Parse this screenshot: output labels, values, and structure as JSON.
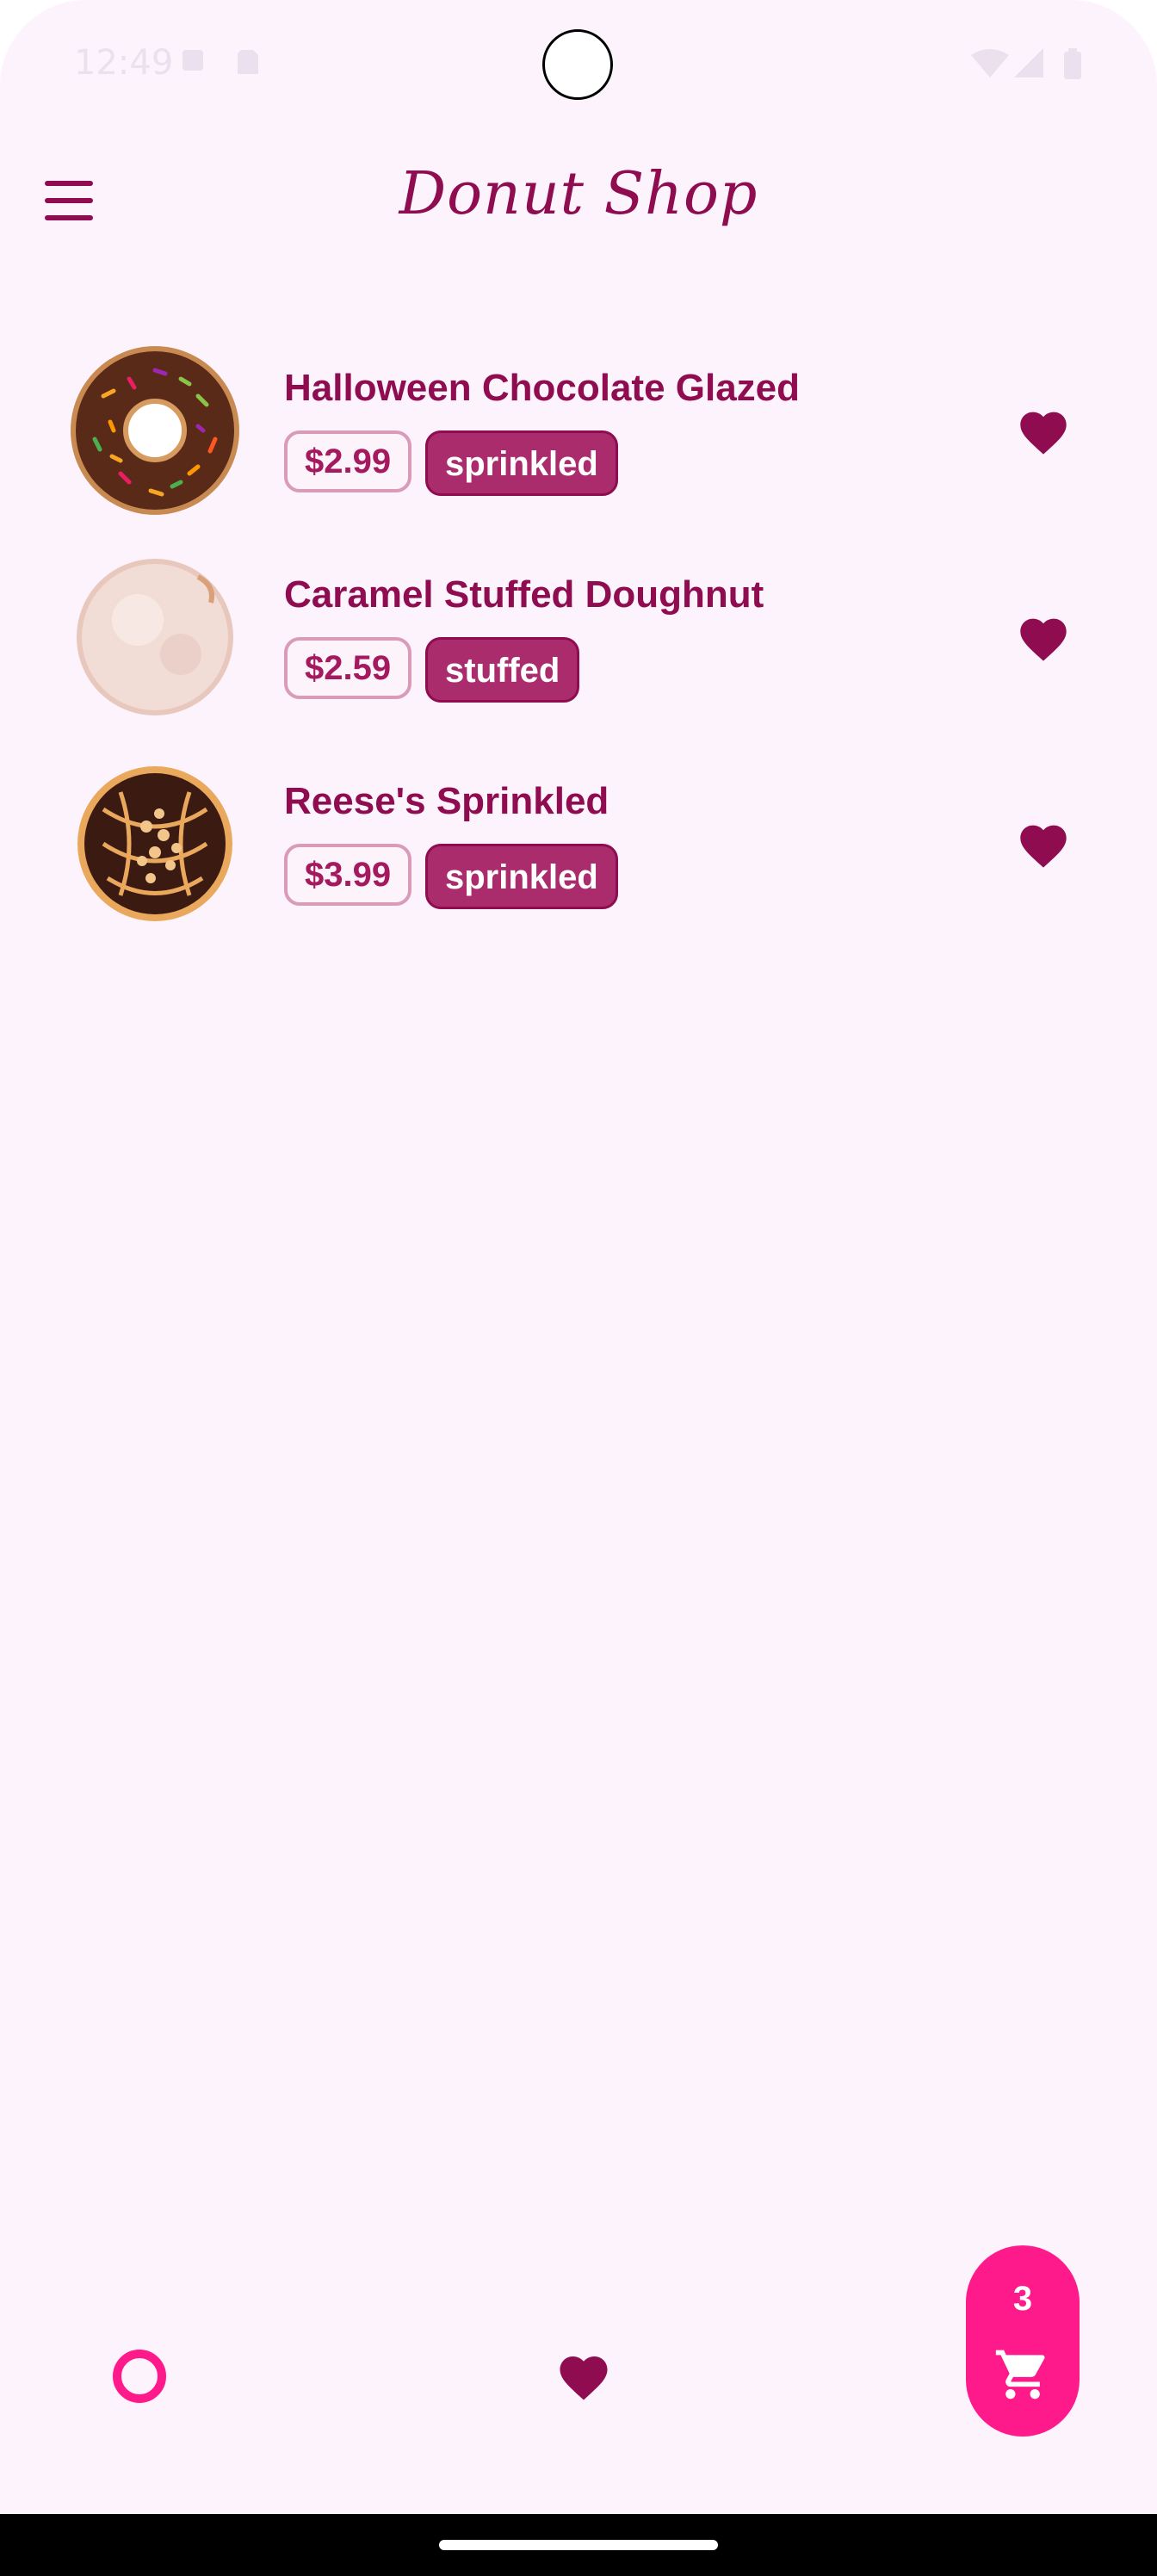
{
  "status_bar": {
    "time": "12:49"
  },
  "app_bar": {
    "title": "Donut Shop"
  },
  "items": [
    {
      "name": "Halloween Chocolate Glazed",
      "price": "$2.99",
      "tag": "sprinkled"
    },
    {
      "name": "Caramel Stuffed Doughnut",
      "price": "$2.59",
      "tag": "stuffed"
    },
    {
      "name": "Reese's Sprinkled",
      "price": "$3.99",
      "tag": "sprinkled"
    }
  ],
  "cart": {
    "count": "3"
  },
  "colors": {
    "primary": "#8e0c4f",
    "accent": "#ff1a8c",
    "background": "#fcf3fc",
    "tag": "#aa2c6d"
  },
  "icons": [
    "menu-icon",
    "heart-icon",
    "donut-icon",
    "cart-icon"
  ]
}
